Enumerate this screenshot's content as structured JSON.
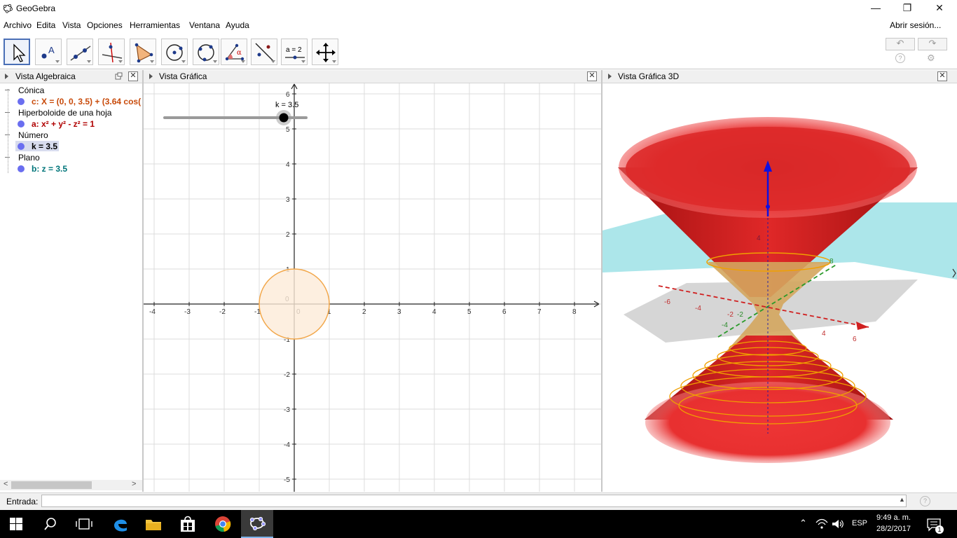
{
  "window": {
    "title": "GeoGebra",
    "minimize": "—",
    "maximize": "❐",
    "close": "✕"
  },
  "menu": {
    "items": [
      "Archivo",
      "Edita",
      "Vista",
      "Opciones",
      "Herramientas",
      "Ventana",
      "Ayuda"
    ],
    "signin": "Abrir sesión..."
  },
  "toolbar": {
    "tools": [
      "move-tool",
      "point-tool",
      "line-tool",
      "perpendicular-tool",
      "polygon-tool",
      "circle-tool",
      "conic-tool",
      "angle-tool",
      "reflect-tool",
      "slider-tool",
      "move-view-tool"
    ],
    "slider_label": "a = 2",
    "undo": "↶",
    "redo": "↷",
    "help": "?",
    "settings": "⚙"
  },
  "algebra": {
    "title": "Vista Algebraica",
    "categories": [
      {
        "name": "Cónica",
        "item": "c: X = (0, 0, 3.5) + (3.64 cos(",
        "color": "#c84a0a"
      },
      {
        "name": "Hiperboloide de una hoja",
        "item": "a: x² + y² - z² = 1",
        "color": "#b00000"
      },
      {
        "name": "Número",
        "item": "k = 3.5",
        "color": "#000000"
      },
      {
        "name": "Plano",
        "item": "b: z = 3.5",
        "color": "#00757a"
      }
    ],
    "scroll_left": "<",
    "scroll_right": ">"
  },
  "graphics2d": {
    "title": "Vista Gráfica",
    "slider_label": "k = 3.5",
    "x_ticks": [
      "-4",
      "-3",
      "-2",
      "-1",
      "0",
      "1",
      "2",
      "3",
      "4",
      "5",
      "6",
      "7",
      "8"
    ],
    "y_ticks": [
      "6",
      "5",
      "4",
      "3",
      "2",
      "1",
      "0",
      "-1",
      "-2",
      "-3",
      "-4",
      "-5"
    ],
    "circle_color": "#f2a74a"
  },
  "graphics3d": {
    "title": "Vista Gráfica 3D",
    "x_labels": [
      "-6",
      "-4",
      "-2",
      "4",
      "6"
    ],
    "y_labels": [
      "-4",
      "-2",
      "8"
    ],
    "z_labels": [
      "4"
    ],
    "surface_color": "#e02020",
    "plane_color": "#9de2e6"
  },
  "input": {
    "label": "Entrada:",
    "value": "",
    "help": "?"
  },
  "taskbar": {
    "language": "ESP",
    "time": "9:49 a. m.",
    "date": "28/2/2017",
    "notif_count": "1"
  }
}
